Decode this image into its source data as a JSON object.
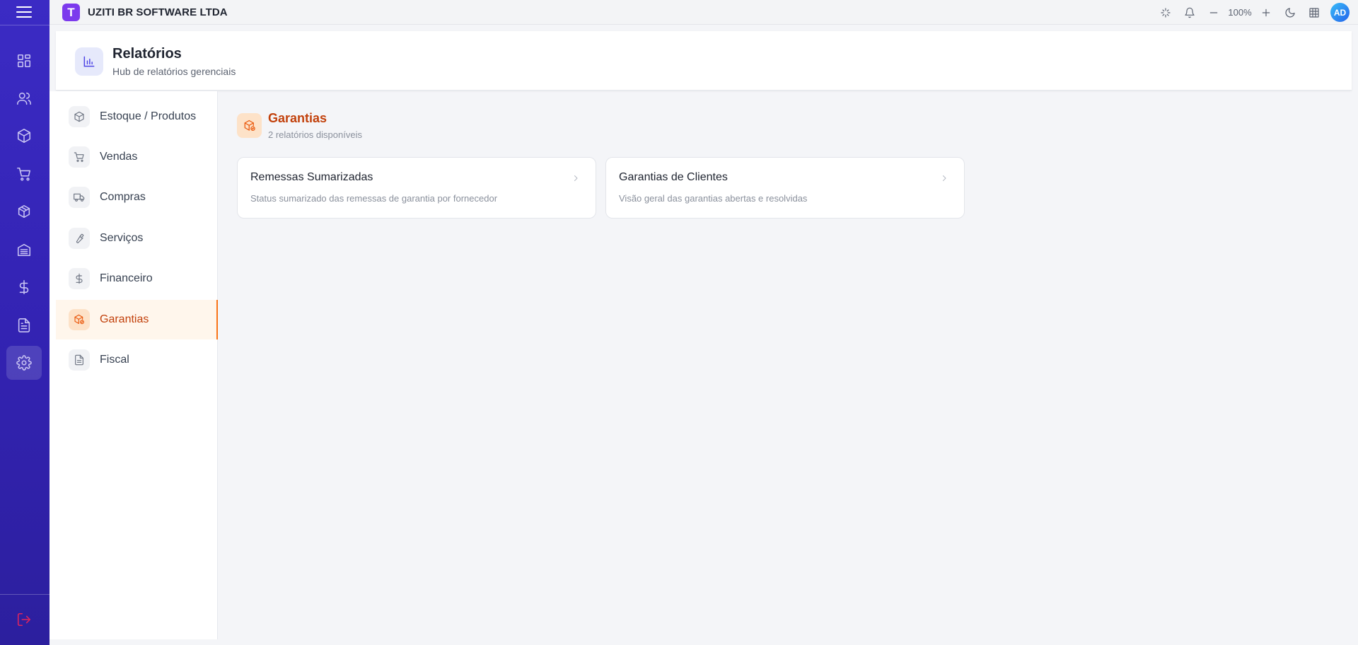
{
  "app": {
    "company_name": "UZITI BR SOFTWARE LTDA",
    "logo_letter": "T",
    "brand_color": "#7c3aed"
  },
  "topbar": {
    "zoom_value": "100%",
    "avatar_initials": "AD",
    "icons": [
      "sparkle-icon",
      "bell-icon",
      "zoom-out-icon",
      "zoom-in-icon",
      "moon-icon",
      "grid-icon"
    ]
  },
  "rail": {
    "items": [
      "dashboard-icon",
      "users-icon",
      "box-icon",
      "cart-icon",
      "package-icon",
      "warehouse-icon",
      "dollar-icon",
      "document-icon",
      "settings-icon"
    ],
    "active": "settings-icon",
    "logout_icon": "logout-icon"
  },
  "header": {
    "title": "Relatórios",
    "subtitle": "Hub de relatórios gerenciais"
  },
  "categories": [
    {
      "label": "Estoque / Produtos",
      "icon": "box-icon"
    },
    {
      "label": "Vendas",
      "icon": "cart-icon"
    },
    {
      "label": "Compras",
      "icon": "truck-icon"
    },
    {
      "label": "Serviços",
      "icon": "wrench-icon"
    },
    {
      "label": "Financeiro",
      "icon": "dollar-icon"
    },
    {
      "label": "Garantias",
      "icon": "warranty-box-icon",
      "active": true
    },
    {
      "label": "Fiscal",
      "icon": "document-icon"
    }
  ],
  "section": {
    "title": "Garantias",
    "subtitle": "2 relatórios disponíveis",
    "accent_color": "#c2410c"
  },
  "reports": [
    {
      "title": "Remessas Sumarizadas",
      "description": "Status sumarizado das remessas de garantia por fornecedor"
    },
    {
      "title": "Garantias de Clientes",
      "description": "Visão geral das garantias abertas e resolvidas"
    }
  ]
}
